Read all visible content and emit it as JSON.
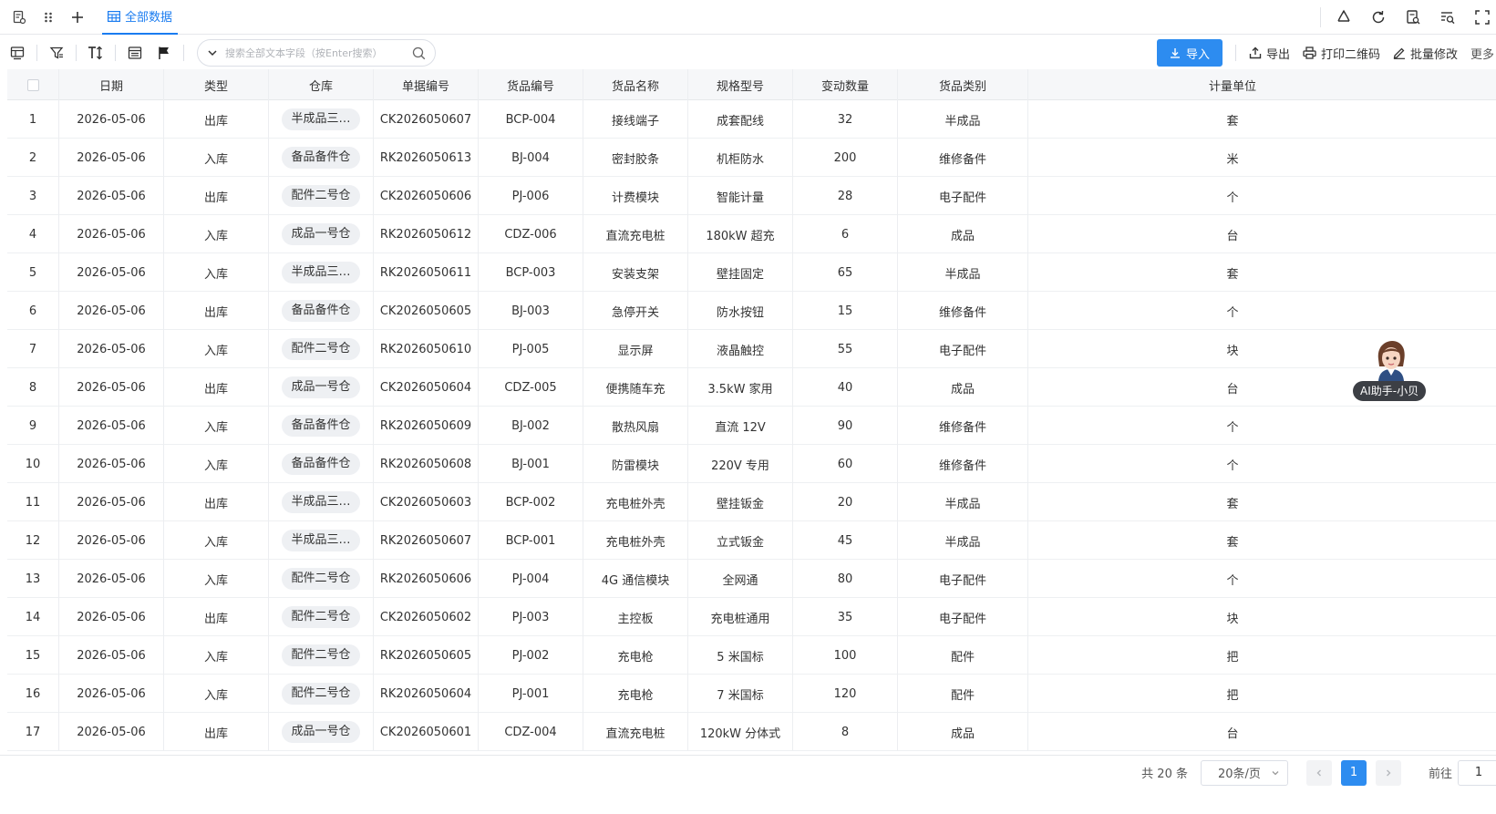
{
  "tabs": {
    "active": "全部数据"
  },
  "toolbar": {
    "search_placeholder": "搜索全部文本字段（按Enter搜索）",
    "import_label": "导入",
    "export_label": "导出",
    "print_qr_label": "打印二维码",
    "batch_edit_label": "批量修改",
    "more_label": "更多"
  },
  "table": {
    "headers": [
      "日期",
      "类型",
      "仓库",
      "单据编号",
      "货品编号",
      "货品名称",
      "规格型号",
      "变动数量",
      "货品类别",
      "计量单位"
    ],
    "rows": [
      {
        "no": "1",
        "date": "2026-05-06",
        "type": "出库",
        "warehouse": "半成品三…",
        "doc": "CK2026050607",
        "code": "BCP-004",
        "name": "接线端子",
        "spec": "成套配线",
        "qty": "32",
        "cat": "半成品",
        "unit": "套"
      },
      {
        "no": "2",
        "date": "2026-05-06",
        "type": "入库",
        "warehouse": "备品备件仓",
        "doc": "RK2026050613",
        "code": "BJ-004",
        "name": "密封胶条",
        "spec": "机柜防水",
        "qty": "200",
        "cat": "维修备件",
        "unit": "米"
      },
      {
        "no": "3",
        "date": "2026-05-06",
        "type": "出库",
        "warehouse": "配件二号仓",
        "doc": "CK2026050606",
        "code": "PJ-006",
        "name": "计费模块",
        "spec": "智能计量",
        "qty": "28",
        "cat": "电子配件",
        "unit": "个"
      },
      {
        "no": "4",
        "date": "2026-05-06",
        "type": "入库",
        "warehouse": "成品一号仓",
        "doc": "RK2026050612",
        "code": "CDZ-006",
        "name": "直流充电桩",
        "spec": "180kW 超充",
        "qty": "6",
        "cat": "成品",
        "unit": "台"
      },
      {
        "no": "5",
        "date": "2026-05-06",
        "type": "入库",
        "warehouse": "半成品三…",
        "doc": "RK2026050611",
        "code": "BCP-003",
        "name": "安装支架",
        "spec": "壁挂固定",
        "qty": "65",
        "cat": "半成品",
        "unit": "套"
      },
      {
        "no": "6",
        "date": "2026-05-06",
        "type": "出库",
        "warehouse": "备品备件仓",
        "doc": "CK2026050605",
        "code": "BJ-003",
        "name": "急停开关",
        "spec": "防水按钮",
        "qty": "15",
        "cat": "维修备件",
        "unit": "个"
      },
      {
        "no": "7",
        "date": "2026-05-06",
        "type": "入库",
        "warehouse": "配件二号仓",
        "doc": "RK2026050610",
        "code": "PJ-005",
        "name": "显示屏",
        "spec": "液晶触控",
        "qty": "55",
        "cat": "电子配件",
        "unit": "块"
      },
      {
        "no": "8",
        "date": "2026-05-06",
        "type": "出库",
        "warehouse": "成品一号仓",
        "doc": "CK2026050604",
        "code": "CDZ-005",
        "name": "便携随车充",
        "spec": "3.5kW 家用",
        "qty": "40",
        "cat": "成品",
        "unit": "台"
      },
      {
        "no": "9",
        "date": "2026-05-06",
        "type": "入库",
        "warehouse": "备品备件仓",
        "doc": "RK2026050609",
        "code": "BJ-002",
        "name": "散热风扇",
        "spec": "直流 12V",
        "qty": "90",
        "cat": "维修备件",
        "unit": "个"
      },
      {
        "no": "10",
        "date": "2026-05-06",
        "type": "入库",
        "warehouse": "备品备件仓",
        "doc": "RK2026050608",
        "code": "BJ-001",
        "name": "防雷模块",
        "spec": "220V 专用",
        "qty": "60",
        "cat": "维修备件",
        "unit": "个"
      },
      {
        "no": "11",
        "date": "2026-05-06",
        "type": "出库",
        "warehouse": "半成品三…",
        "doc": "CK2026050603",
        "code": "BCP-002",
        "name": "充电桩外壳",
        "spec": "壁挂钣金",
        "qty": "20",
        "cat": "半成品",
        "unit": "套"
      },
      {
        "no": "12",
        "date": "2026-05-06",
        "type": "入库",
        "warehouse": "半成品三…",
        "doc": "RK2026050607",
        "code": "BCP-001",
        "name": "充电桩外壳",
        "spec": "立式钣金",
        "qty": "45",
        "cat": "半成品",
        "unit": "套"
      },
      {
        "no": "13",
        "date": "2026-05-06",
        "type": "入库",
        "warehouse": "配件二号仓",
        "doc": "RK2026050606",
        "code": "PJ-004",
        "name": "4G 通信模块",
        "spec": "全网通",
        "qty": "80",
        "cat": "电子配件",
        "unit": "个"
      },
      {
        "no": "14",
        "date": "2026-05-06",
        "type": "出库",
        "warehouse": "配件二号仓",
        "doc": "CK2026050602",
        "code": "PJ-003",
        "name": "主控板",
        "spec": "充电桩通用",
        "qty": "35",
        "cat": "电子配件",
        "unit": "块"
      },
      {
        "no": "15",
        "date": "2026-05-06",
        "type": "入库",
        "warehouse": "配件二号仓",
        "doc": "RK2026050605",
        "code": "PJ-002",
        "name": "充电枪",
        "spec": "5 米国标",
        "qty": "100",
        "cat": "配件",
        "unit": "把"
      },
      {
        "no": "16",
        "date": "2026-05-06",
        "type": "入库",
        "warehouse": "配件二号仓",
        "doc": "RK2026050604",
        "code": "PJ-001",
        "name": "充电枪",
        "spec": "7 米国标",
        "qty": "120",
        "cat": "配件",
        "unit": "把"
      },
      {
        "no": "17",
        "date": "2026-05-06",
        "type": "出库",
        "warehouse": "成品一号仓",
        "doc": "CK2026050601",
        "code": "CDZ-004",
        "name": "直流充电桩",
        "spec": "120kW 分体式",
        "qty": "8",
        "cat": "成品",
        "unit": "台"
      }
    ]
  },
  "pagination": {
    "total_text": "共 20 条",
    "page_size": "20条/页",
    "current_page": "1",
    "goto_label": "前往",
    "goto_value": "1"
  },
  "ai_assistant": {
    "label": "AI助手-小贝"
  },
  "colors": {
    "accent": "#2d8cf0",
    "tab_active": "#1a7cf0"
  }
}
